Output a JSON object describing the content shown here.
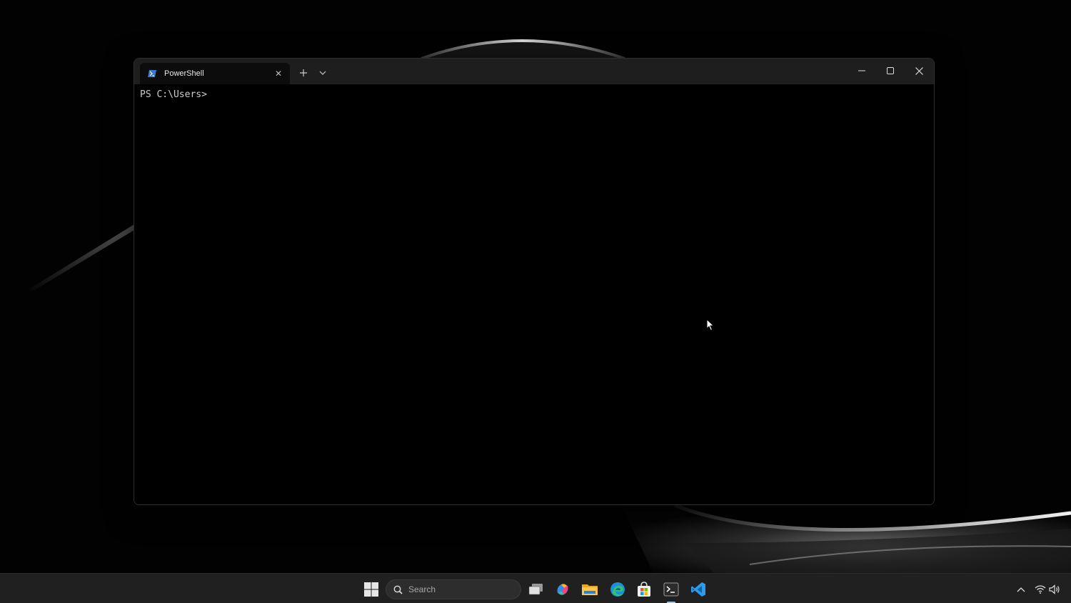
{
  "window": {
    "tab_title": "PowerShell",
    "tab_close_glyph": "✕",
    "new_tab_glyph": "+",
    "prompt_line": "PS C:\\Users>"
  },
  "taskbar": {
    "search_placeholder": "Search",
    "pinned": [
      "start-icon",
      "task-view-icon",
      "copilot-icon",
      "file-explorer-icon",
      "edge-icon",
      "store-icon",
      "terminal-icon",
      "vscode-icon"
    ],
    "active_app": "terminal-icon"
  },
  "tray": {
    "icons": [
      "chevron-up-icon",
      "wifi-icon",
      "volume-icon"
    ]
  },
  "colors": {
    "titlebar": "#1e1e1e",
    "tab_active": "#0c0c0c",
    "terminal_bg": "#000000",
    "terminal_text": "#cccccc",
    "taskbar": "#202020",
    "vscode_blue": "#2d9cf0"
  }
}
